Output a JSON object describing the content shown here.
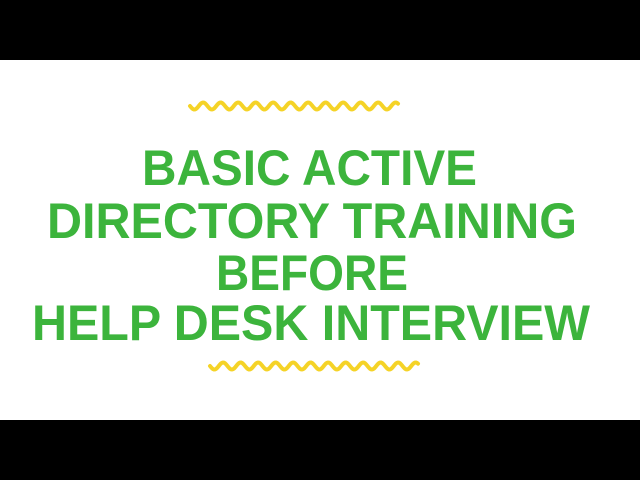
{
  "title_lines": [
    "BASIC ACTIVE",
    "DIRECTORY TRAINING",
    "BEFORE",
    "HELP DESK INTERVIEW"
  ],
  "colors": {
    "text": "#3cb43c",
    "wave": "#f5d327",
    "background": "#ffffff",
    "letterbox": "#000000"
  },
  "decorations": [
    "wavy-line-top",
    "wavy-line-bottom"
  ]
}
